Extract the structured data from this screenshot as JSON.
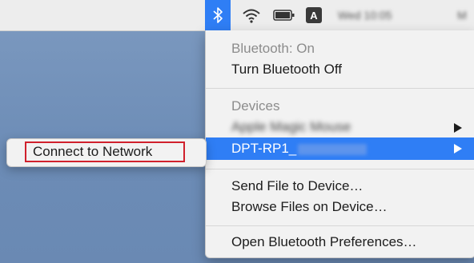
{
  "menubar": {
    "bluetooth_icon": "bluetooth-icon",
    "wifi_icon": "wifi-icon",
    "battery_icon": "battery-icon",
    "input_source_label": "A",
    "clock_label": "Wed 10:05",
    "user_label": "M"
  },
  "bluetooth_menu": {
    "status_label": "Bluetooth: On",
    "toggle_label": "Turn Bluetooth Off",
    "devices_header": "Devices",
    "device_1_label": "Apple Magic Mouse",
    "device_2_label": "DPT-RP1_",
    "send_file_label": "Send File to Device…",
    "browse_files_label": "Browse Files on Device…",
    "preferences_label": "Open Bluetooth Preferences…"
  },
  "submenu": {
    "connect_label": "Connect to Network"
  },
  "colors": {
    "accent": "#2f7ef5",
    "highlight_box": "#d0202c",
    "desktop": "#6f8fb8"
  }
}
